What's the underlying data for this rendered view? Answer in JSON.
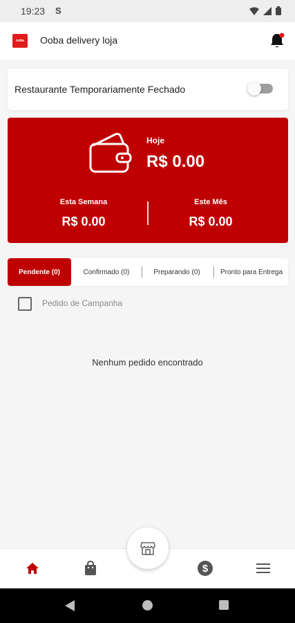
{
  "status_bar": {
    "time": "19:23",
    "extra": "S"
  },
  "app_bar": {
    "logo_text": "ooba",
    "title": "Ooba delivery loja",
    "notification_icon": "bell-icon"
  },
  "store_status": {
    "label": "Restaurante Temporariamente Fechado",
    "toggle_on": false
  },
  "revenue": {
    "today_label": "Hoje",
    "today_value": "R$ 0.00",
    "week_label": "Esta Semana",
    "week_value": "R$ 0.00",
    "month_label": "Este Mês",
    "month_value": "R$ 0.00",
    "background_color": "#bf0000"
  },
  "tabs": [
    {
      "label": "Pendente (0)",
      "active": true
    },
    {
      "label": "Confirmado (0)",
      "active": false
    },
    {
      "label": "Preparando (0)",
      "active": false
    },
    {
      "label": "Pronto para Entrega",
      "active": false
    }
  ],
  "filter": {
    "label": "Pedido de Campanha",
    "checked": false
  },
  "empty_message": "Nenhum pedido encontrado",
  "bottom_nav": {
    "items": [
      "home-icon",
      "shopping-bag-icon",
      "store-icon",
      "dollar-icon",
      "menu-icon"
    ],
    "active": "home-icon",
    "accent": "#bf0000"
  }
}
